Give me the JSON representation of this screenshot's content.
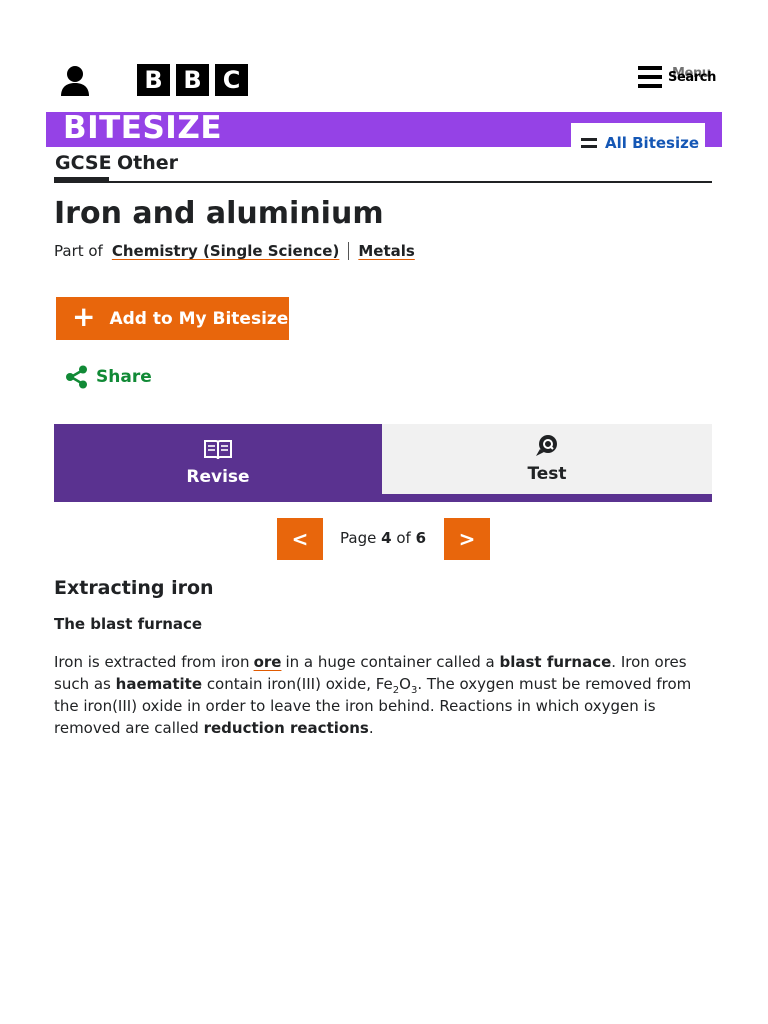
{
  "header": {
    "logo_letters": [
      "B",
      "B",
      "C"
    ],
    "menu_label": "Search",
    "menu_label_ghost": "Menu",
    "account_icon": "user-icon"
  },
  "bitesize": {
    "brand": "BITESIZE",
    "all_bitesize_label": "All Bitesize",
    "brand_color": "#9542e6"
  },
  "subnav": {
    "items": [
      {
        "label": "GCSE",
        "active": true
      },
      {
        "label": "Other",
        "active": false
      }
    ]
  },
  "page": {
    "title": "Iron and aluminium",
    "part_of_label": "Part of",
    "breadcrumbs": [
      "Chemistry (Single Science)",
      "Metals"
    ]
  },
  "actions": {
    "add_label": "Add to My Bitesize",
    "share_label": "Share",
    "accent": "#e8660c",
    "share_color": "#118a36"
  },
  "tabs": [
    {
      "label": "Revise",
      "icon": "book-icon",
      "active": true
    },
    {
      "label": "Test",
      "icon": "quiz-bubble-icon",
      "active": false
    }
  ],
  "pager": {
    "prev": "<",
    "next": ">",
    "page_word": "Page",
    "current": "4",
    "of_word": "of",
    "total": "6"
  },
  "article": {
    "heading": "Extracting iron",
    "subheading": "The blast furnace",
    "p1": {
      "t1": "Iron is extracted from iron",
      "link_ore": "ore",
      "t2": "in a huge container called a",
      "b_blast_furnace": "blast furnace",
      "t3": ". Iron ores such as",
      "b_haematite": "haematite",
      "t4": "contain iron(III) oxide, Fe",
      "sub_2": "2",
      "t5": "O",
      "sub_3": "3",
      "t6": ". The oxygen must be removed from the iron(III) oxide in order to leave the iron behind. Reactions in which oxygen is removed are called",
      "b_reduction": "reduction reactions",
      "t7": "."
    }
  }
}
